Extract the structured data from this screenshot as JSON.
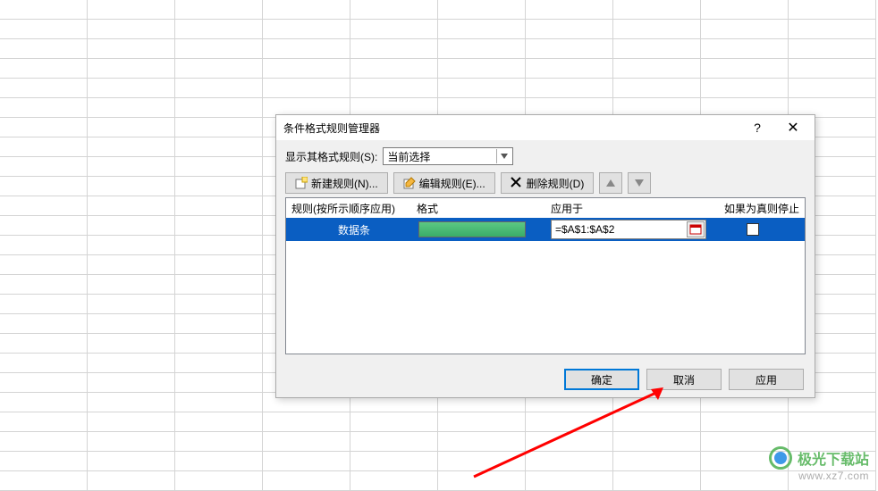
{
  "dialog": {
    "title": "条件格式规则管理器",
    "help_icon": "?",
    "close_icon": "✕",
    "show_rules_label": "显示其格式规则(S):",
    "scope_selected": "当前选择",
    "toolbar": {
      "new_rule": "新建规则(N)...",
      "edit_rule": "编辑规则(E)...",
      "delete_rule": "删除规则(D)",
      "move_up": "▲",
      "move_down": "▼"
    },
    "headers": {
      "rule": "规则(按所示顺序应用)",
      "format": "格式",
      "applies_to": "应用于",
      "stop_if_true": "如果为真则停止"
    },
    "rules": [
      {
        "name": "数据条",
        "applies_to": "=$A$1:$A$2",
        "stop": false
      }
    ],
    "footer": {
      "ok": "确定",
      "cancel": "取消",
      "apply": "应用"
    }
  },
  "watermark": {
    "brand": "极光下载站",
    "url": "www.xz7.com"
  }
}
